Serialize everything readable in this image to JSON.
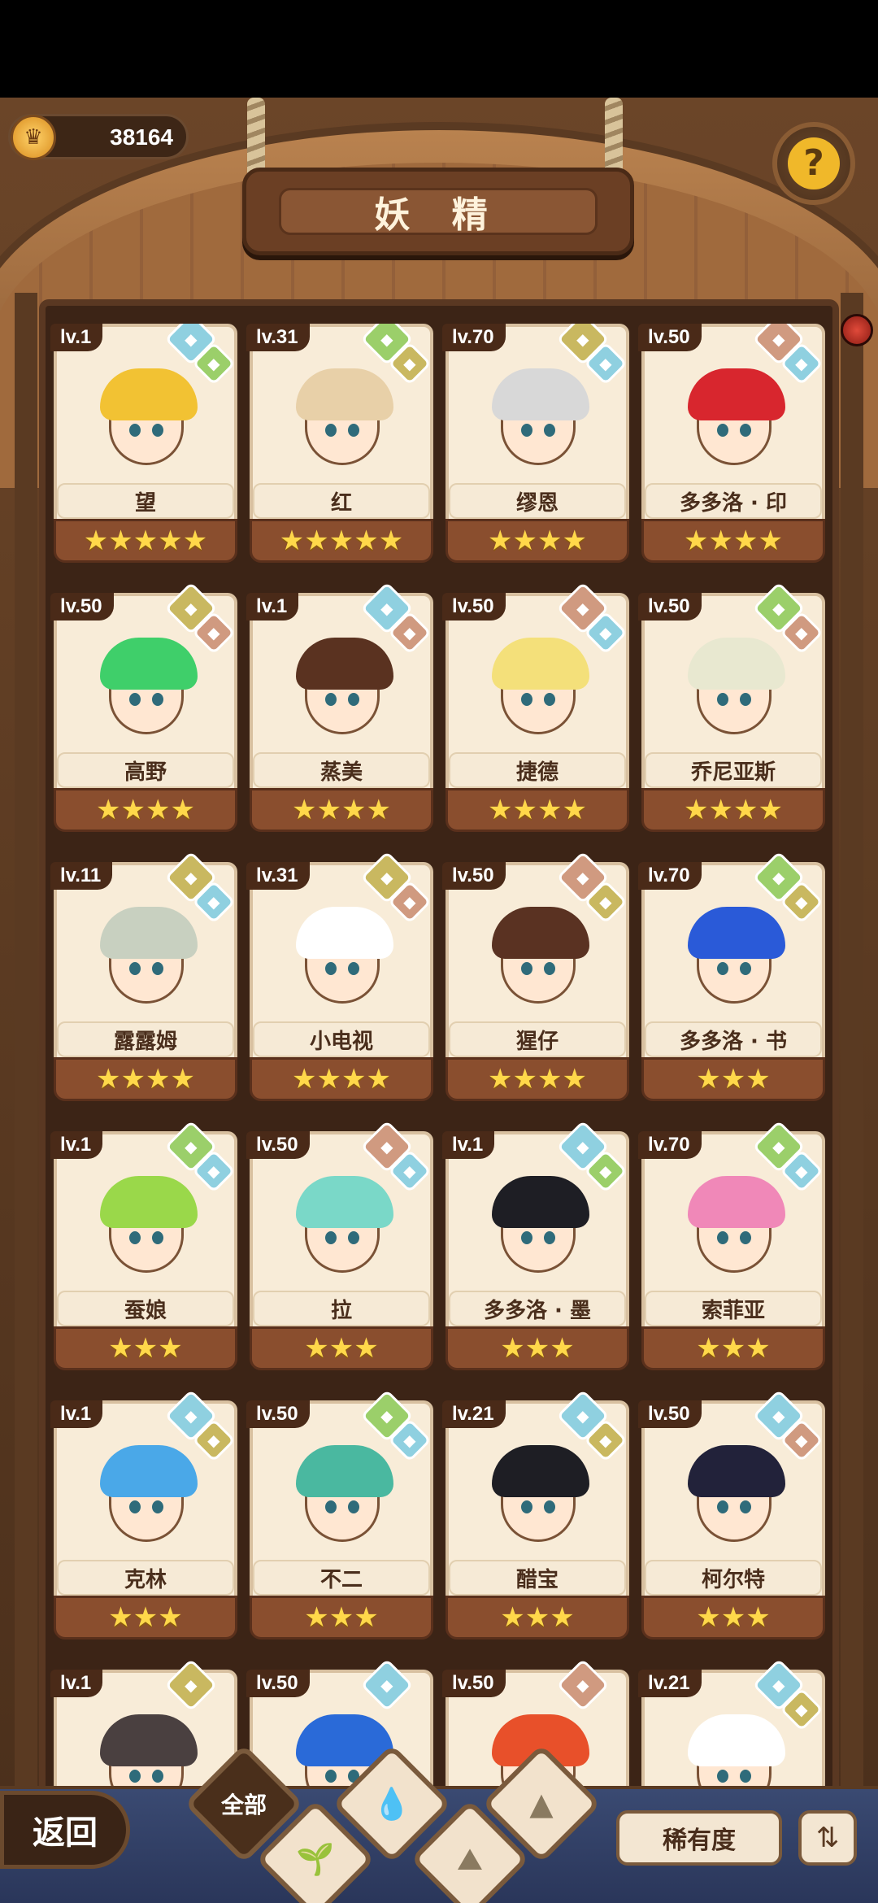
{
  "currency": {
    "value": "38164",
    "icon": "crown-coin-icon"
  },
  "title": "妖 精",
  "help_icon": "question-mark-icon",
  "cards": [
    {
      "level": "lv.1",
      "name": "望",
      "stars": "★★★★★",
      "hair": "#f2c233",
      "elems": [
        "#8fd0e0",
        "#9bcf6a"
      ]
    },
    {
      "level": "lv.31",
      "name": "红",
      "stars": "★★★★★",
      "hair": "#e8d0a8",
      "elems": [
        "#9bcf6a",
        "#c9b860"
      ]
    },
    {
      "level": "lv.70",
      "name": "缪恩",
      "stars": "★★★★",
      "hair": "#d8d8d8",
      "elems": [
        "#c9b860",
        "#8fd0e0"
      ]
    },
    {
      "level": "lv.50",
      "name": "多多洛 · 印",
      "stars": "★★★★",
      "hair": "#d8262e",
      "elems": [
        "#d09a80",
        "#8fd0e0"
      ]
    },
    {
      "level": "lv.50",
      "name": "高野",
      "stars": "★★★★",
      "hair": "#3fcf6a",
      "elems": [
        "#c9b860",
        "#d09a80"
      ]
    },
    {
      "level": "lv.1",
      "name": "蒸美",
      "stars": "★★★★",
      "hair": "#5a3220",
      "elems": [
        "#8fd0e0",
        "#d09a80"
      ]
    },
    {
      "level": "lv.50",
      "name": "捷德",
      "stars": "★★★★",
      "hair": "#f4e07a",
      "elems": [
        "#d09a80",
        "#8fd0e0"
      ]
    },
    {
      "level": "lv.50",
      "name": "乔尼亚斯",
      "stars": "★★★★",
      "hair": "#e8e8d0",
      "elems": [
        "#9bcf6a",
        "#d09a80"
      ]
    },
    {
      "level": "lv.11",
      "name": "露露姆",
      "stars": "★★★★",
      "hair": "#c8d0c0",
      "elems": [
        "#c9b860",
        "#8fd0e0"
      ]
    },
    {
      "level": "lv.31",
      "name": "小电视",
      "stars": "★★★★",
      "hair": "#ffffff",
      "elems": [
        "#c9b860",
        "#d09a80"
      ]
    },
    {
      "level": "lv.50",
      "name": "猩仔",
      "stars": "★★★★",
      "hair": "#5a3222",
      "elems": [
        "#d09a80",
        "#c9b860"
      ]
    },
    {
      "level": "lv.70",
      "name": "多多洛 · 书",
      "stars": "★★★",
      "hair": "#2a5ad8",
      "elems": [
        "#9bcf6a",
        "#c9b860"
      ]
    },
    {
      "level": "lv.1",
      "name": "蚕娘",
      "stars": "★★★",
      "hair": "#9ad84a",
      "elems": [
        "#9bcf6a",
        "#8fd0e0"
      ]
    },
    {
      "level": "lv.50",
      "name": "拉",
      "stars": "★★★",
      "hair": "#7ad8c8",
      "elems": [
        "#d09a80",
        "#8fd0e0"
      ]
    },
    {
      "level": "lv.1",
      "name": "多多洛 · 墨",
      "stars": "★★★",
      "hair": "#1e1e24",
      "elems": [
        "#8fd0e0",
        "#9bcf6a"
      ]
    },
    {
      "level": "lv.70",
      "name": "索菲亚",
      "stars": "★★★",
      "hair": "#f088b8",
      "elems": [
        "#9bcf6a",
        "#8fd0e0"
      ]
    },
    {
      "level": "lv.1",
      "name": "克林",
      "stars": "★★★",
      "hair": "#4aa8e8",
      "elems": [
        "#8fd0e0",
        "#c9b860"
      ]
    },
    {
      "level": "lv.50",
      "name": "不二",
      "stars": "★★★",
      "hair": "#4ab8a0",
      "elems": [
        "#9bcf6a",
        "#8fd0e0"
      ]
    },
    {
      "level": "lv.21",
      "name": "醋宝",
      "stars": "★★★",
      "hair": "#1e1e24",
      "elems": [
        "#8fd0e0",
        "#c9b860"
      ]
    },
    {
      "level": "lv.50",
      "name": "柯尔特",
      "stars": "★★★",
      "hair": "#22223a",
      "elems": [
        "#8fd0e0",
        "#d09a80"
      ]
    },
    {
      "level": "lv.1",
      "name": "",
      "stars": "",
      "hair": "#4a4040",
      "elems": [
        "#c9b860",
        ""
      ]
    },
    {
      "level": "lv.50",
      "name": "",
      "stars": "",
      "hair": "#2a6ad8",
      "elems": [
        "#8fd0e0",
        ""
      ]
    },
    {
      "level": "lv.50",
      "name": "",
      "stars": "",
      "hair": "#e8502a",
      "elems": [
        "#d09a80",
        ""
      ]
    },
    {
      "level": "lv.21",
      "name": "",
      "stars": "",
      "hair": "#ffffff",
      "elems": [
        "#8fd0e0",
        "#c9b860"
      ]
    }
  ],
  "bottom": {
    "back_label": "返回",
    "tab_all": "全部",
    "sort_label": "稀有度",
    "order_icon": "sort-order-icon"
  }
}
